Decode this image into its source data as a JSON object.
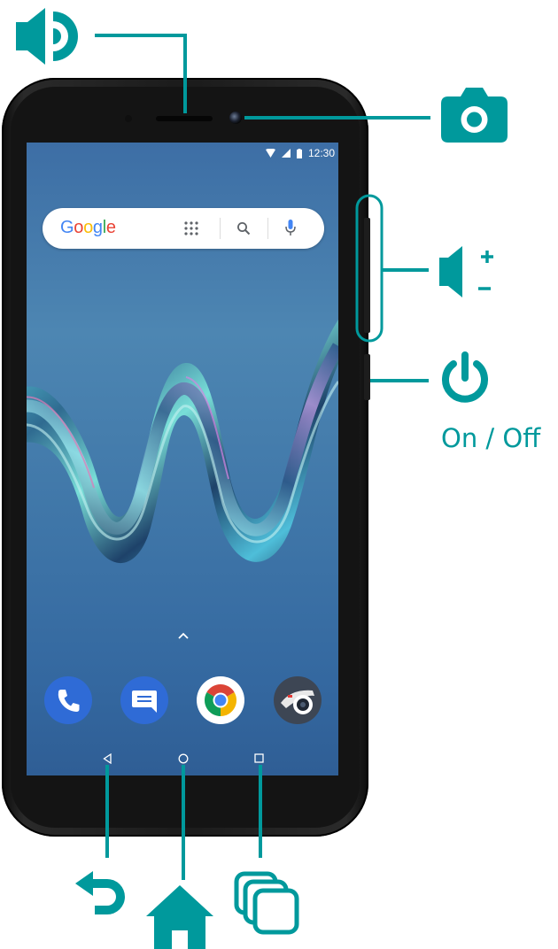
{
  "phone": {
    "status_time": "12:30",
    "search_logo": "Google",
    "search_icons": [
      "apps-grid-icon",
      "search-icon",
      "microphone-icon"
    ],
    "dock_apps": [
      "phone-app-icon",
      "messages-app-icon",
      "chrome-app-icon",
      "camera-app-icon"
    ],
    "nav_buttons": [
      "back-button",
      "home-button",
      "recents-button"
    ]
  },
  "callouts": {
    "speaker": "speaker-icon",
    "front_camera": "camera-icon",
    "volume": "volume-icon",
    "power": "power-icon",
    "power_label": "On / Off",
    "back": "back-arrow-icon",
    "home": "home-icon",
    "recents": "recents-icon"
  },
  "colors": {
    "accent": "#00999c",
    "phone_body": "#1b1b1b",
    "screen_top": "#3d6ea5",
    "screen_bottom": "#2f5e95"
  }
}
